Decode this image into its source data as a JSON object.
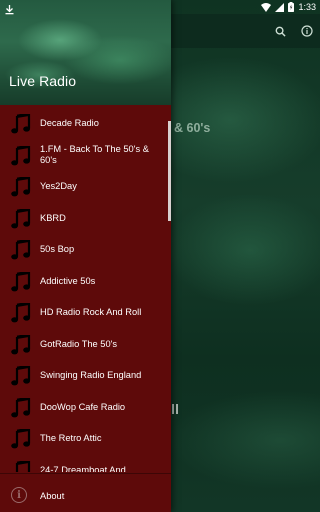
{
  "background": {
    "heading_fragment": "& 60's"
  },
  "drawer": {
    "title": "Live Radio",
    "stations": [
      "Decade Radio",
      "1.FM - Back To The 50's & 60's",
      "Yes2Day",
      "KBRD",
      "50s Bop",
      "Addictive 50s",
      "HD Radio Rock And Roll",
      "GotRadio The 50's",
      "Swinging Radio England",
      "DooWop Cafe Radio",
      "The Retro Attic",
      "24-7 Dreamboat And"
    ],
    "footer_label": "About"
  },
  "status_bar": {
    "time": "1:33"
  },
  "colors": {
    "drawer_bg": "#5e0a0a",
    "header_green": "#2e6a4c",
    "app_bg": "#163d2b"
  },
  "icons": {
    "station": "music-note-icon",
    "about": "info-icon",
    "search": "search-icon",
    "info": "info-icon"
  }
}
